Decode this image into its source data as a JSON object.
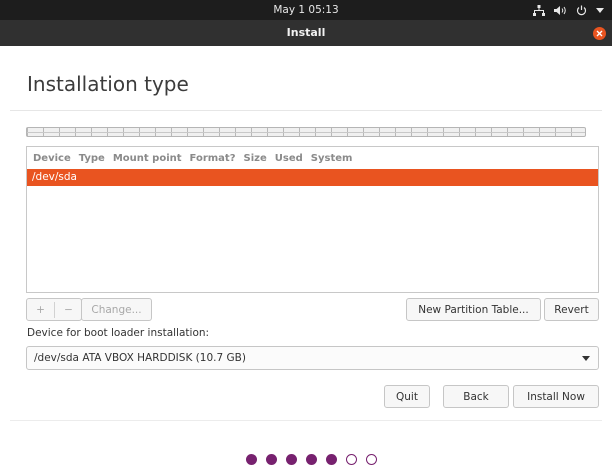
{
  "topbar": {
    "clock": "May 1  05:13",
    "icons": [
      "network-icon",
      "volume-icon",
      "power-icon",
      "chevron-down-icon"
    ]
  },
  "window": {
    "title": "Install",
    "close_icon": "close-icon"
  },
  "page": {
    "heading": "Installation type"
  },
  "partition_table": {
    "columns": [
      "Device",
      "Type",
      "Mount point",
      "Format?",
      "Size",
      "Used",
      "System"
    ],
    "rows": [
      {
        "device": "/dev/sda",
        "selected": true
      }
    ]
  },
  "toolbar": {
    "add_label": "+",
    "remove_label": "−",
    "change_label": "Change...",
    "new_table_label": "New Partition Table...",
    "revert_label": "Revert"
  },
  "bootloader": {
    "label": "Device for boot loader installation:",
    "selected": "/dev/sda ATA VBOX HARDDISK (10.7 GB)"
  },
  "actions": {
    "quit_label": "Quit",
    "back_label": "Back",
    "install_label": "Install Now"
  },
  "progress": {
    "total_steps": 7,
    "completed_steps": 5
  },
  "colors": {
    "accent": "#e95420",
    "step": "#77216f"
  }
}
